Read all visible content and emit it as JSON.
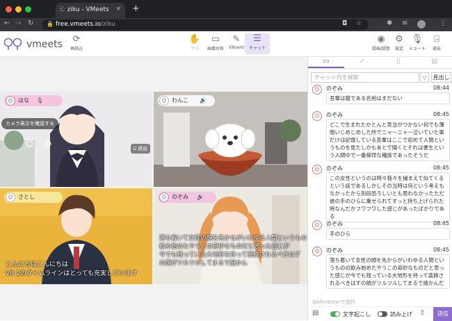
{
  "browser": {
    "tab_title": "ziku - VMeets",
    "url_domain": "free.vmeets.io",
    "url_path": "/ziku",
    "new_tab": "+",
    "tab_close": "×"
  },
  "app": {
    "logo_text": "vmeets",
    "header_left": [
      {
        "label": "再読込",
        "icon": "reload-icon"
      }
    ],
    "header_center": [
      {
        "label": "アバ",
        "icon": "avatar-icon"
      },
      {
        "label": "画面共有",
        "icon": "monitor-icon"
      },
      {
        "label": "VBoard",
        "icon": "pen-icon"
      },
      {
        "label": "チャット",
        "icon": "chat-icon"
      }
    ],
    "header_right": [
      {
        "label": "録画/録音",
        "icon": "record-icon"
      },
      {
        "label": "設定",
        "icon": "gear-icon"
      },
      {
        "label": "ミュート",
        "icon": "mic-icon"
      },
      {
        "label": "退出",
        "icon": "exit-icon"
      }
    ]
  },
  "tiles": [
    {
      "name": "はな",
      "camera_pill": "カメラ表示を確認する",
      "leave": "退出"
    },
    {
      "name": "わんこ"
    },
    {
      "name": "さとし",
      "subtitle": "こんにちはこんにちは\nVB 2のタイムラインはとっても充実しています"
    },
    {
      "name": "のぞみ",
      "subtitle": "落ち着いて女性の顔を先からがいわゆる人間というもの飲み始めたやうこの奇妙なものだと思った感じが\n今でも残っている大地形を持って装飾されるべきはず\nの顔がツルツルしてまるで焼かん"
    }
  ],
  "chat": {
    "search_placeholder": "チャット内を検索",
    "midashi": "見出し",
    "filter_icon": "filter-icon",
    "messages": [
      {
        "sender": "のぞみ",
        "time": "08:44",
        "text": "吾輩は猫である名前はまだない"
      },
      {
        "sender": "のぞみ",
        "time": "08:45",
        "text": "どこで生まれたかとんと見当がつかない何でも薄暗いじめじめした所でニャーニャー泣いていた事だけは記憶している吾輩はここで初めて人間というものを見たしかもあとで聞くとそれは書生という人間中で一番獰悍な種族であったそうだ"
      },
      {
        "sender": "のぞみ",
        "time": "08:45",
        "text": "この女性というのは時々我々を捕まえて似てくるという話であるしかしその当時は何という考えもなかったから別段恐ろしいとも思わなかったただ彼の手のひらに乗せられてすっと持ち上げられた時なんだかフワフワした感じがあったばかりである"
      },
      {
        "sender": "のぞみ",
        "time": "08:45",
        "text": "手のひら"
      },
      {
        "sender": "のぞみ",
        "time": "08:45",
        "text": "落ち着いて女性の顔を先からがいわゆる人間というものの飲み始めたやうこの奇妙なものだと思った感じが今でも残っている大地形を持って装飾されるべきはずの顔がツルツルしてまるで焼かんだ"
      }
    ],
    "hint": "Shift+Enterで改行",
    "transcribe_label": "文字起こし",
    "readaloud_label": "読み上げ",
    "send_label": "送信"
  },
  "colors": {
    "accent": "#8e6cd0",
    "tab_bg": "#202124",
    "toggle_on": "#4caf50"
  }
}
